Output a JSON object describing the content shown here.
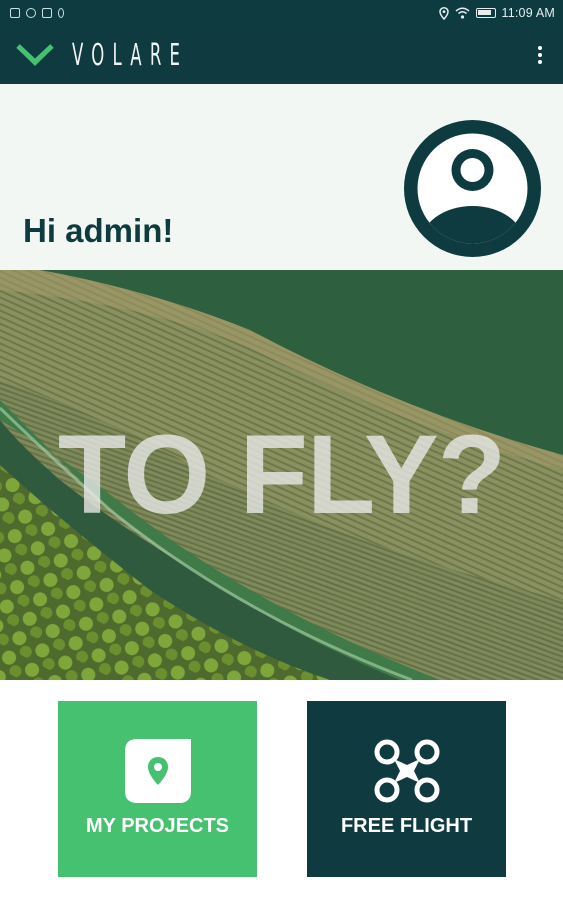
{
  "status_bar": {
    "left_icons": [
      "gallery-icon",
      "shield-icon",
      "youtube-icon",
      "person-icon"
    ],
    "right_icons": [
      "location-icon",
      "wifi-icon",
      "battery-icon"
    ],
    "time": "11:09 AM"
  },
  "app_bar": {
    "brand": "VOLARE",
    "menu_icon": "more-vert-icon"
  },
  "greeting": {
    "text": "Hi admin!",
    "avatar_icon": "account-circle-icon"
  },
  "hero": {
    "text": "TO FLY?"
  },
  "actions": {
    "projects": {
      "label": "MY PROJECTS",
      "icon": "map-pin-icon"
    },
    "free_flight": {
      "label": "FREE FLIGHT",
      "icon": "drone-icon"
    }
  },
  "colors": {
    "primary_dark": "#0f3a3f",
    "accent_green": "#45c16f",
    "greeting_bg": "#f2f7f4"
  }
}
